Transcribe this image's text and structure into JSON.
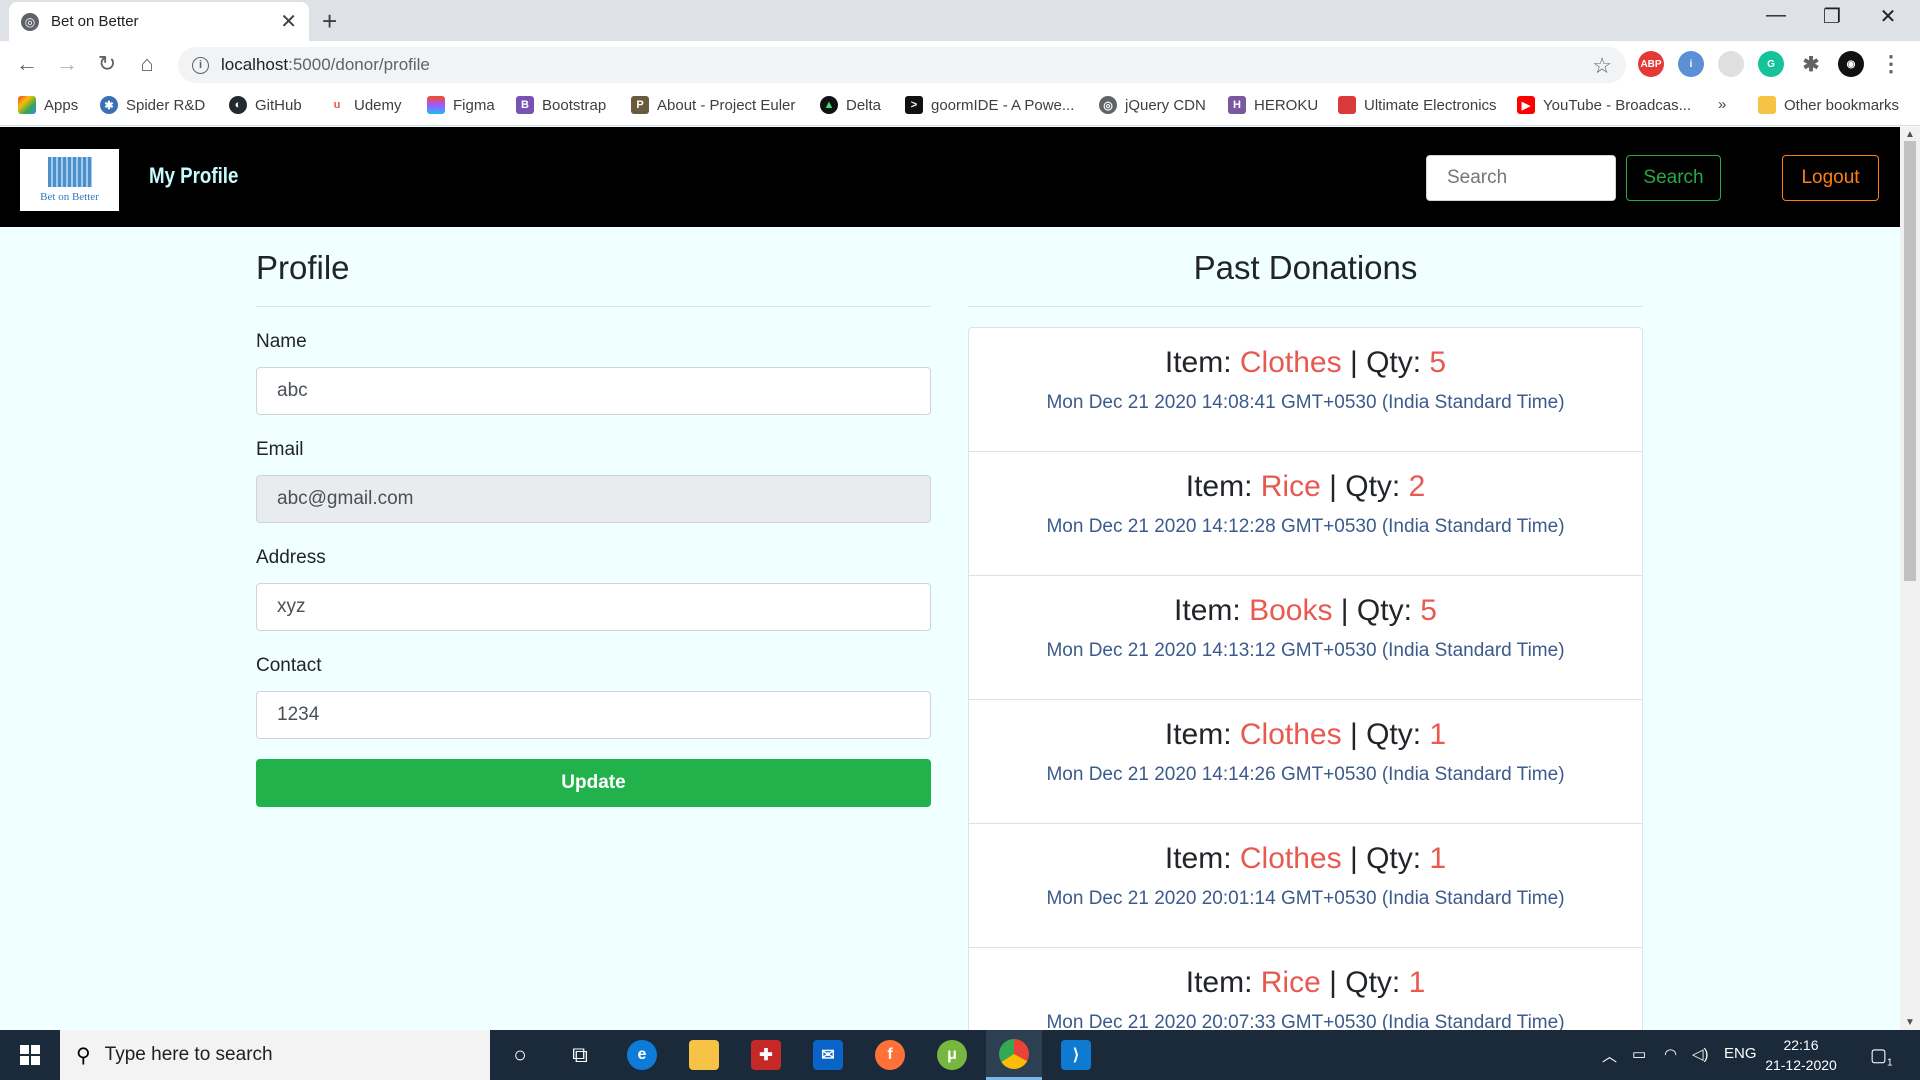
{
  "browser": {
    "tab_title": "Bet on Better",
    "url_host": "localhost",
    "url_rest": ":5000/donor/profile",
    "bookmarks": [
      "Apps",
      "Spider R&D",
      "GitHub",
      "Udemy",
      "Figma",
      "Bootstrap",
      "About - Project Euler",
      "Delta",
      "goormIDE - A Powe...",
      "jQuery CDN",
      "HEROKU",
      "Ultimate Electronics",
      "YouTube - Broadcas..."
    ],
    "more_bookmarks": "»",
    "other_bookmarks": "Other bookmarks"
  },
  "navbar": {
    "logo_text": "Bet on Better",
    "brand": "My Profile",
    "search_placeholder": "Search",
    "search_button": "Search",
    "logout_button": "Logout"
  },
  "profile": {
    "heading": "Profile",
    "name_label": "Name",
    "name_value": "abc",
    "email_label": "Email",
    "email_value": "abc@gmail.com",
    "address_label": "Address",
    "address_value": "xyz",
    "contact_label": "Contact",
    "contact_value": "1234",
    "update_button": "Update"
  },
  "donations": {
    "heading": "Past Donations",
    "item_prefix": "Item: ",
    "qty_prefix": " | Qty: ",
    "items": [
      {
        "item": "Clothes",
        "qty": "5",
        "date": "Mon Dec 21 2020 14:08:41 GMT+0530 (India Standard Time)"
      },
      {
        "item": "Rice",
        "qty": "2",
        "date": "Mon Dec 21 2020 14:12:28 GMT+0530 (India Standard Time)"
      },
      {
        "item": "Books",
        "qty": "5",
        "date": "Mon Dec 21 2020 14:13:12 GMT+0530 (India Standard Time)"
      },
      {
        "item": "Clothes",
        "qty": "1",
        "date": "Mon Dec 21 2020 14:14:26 GMT+0530 (India Standard Time)"
      },
      {
        "item": "Clothes",
        "qty": "1",
        "date": "Mon Dec 21 2020 20:01:14 GMT+0530 (India Standard Time)"
      },
      {
        "item": "Rice",
        "qty": "1",
        "date": "Mon Dec 21 2020 20:07:33 GMT+0530 (India Standard Time)"
      }
    ]
  },
  "taskbar": {
    "search_placeholder": "Type here to search",
    "language": "ENG",
    "time": "22:16",
    "date": "21-12-2020",
    "notification_count": "1"
  },
  "colors": {
    "navbar_bg": "#000000",
    "page_bg": "#f0ffff",
    "accent_red": "#e85a50",
    "update_green": "#21b24b",
    "search_green": "#28a745",
    "logout_orange": "#fd7e14"
  }
}
